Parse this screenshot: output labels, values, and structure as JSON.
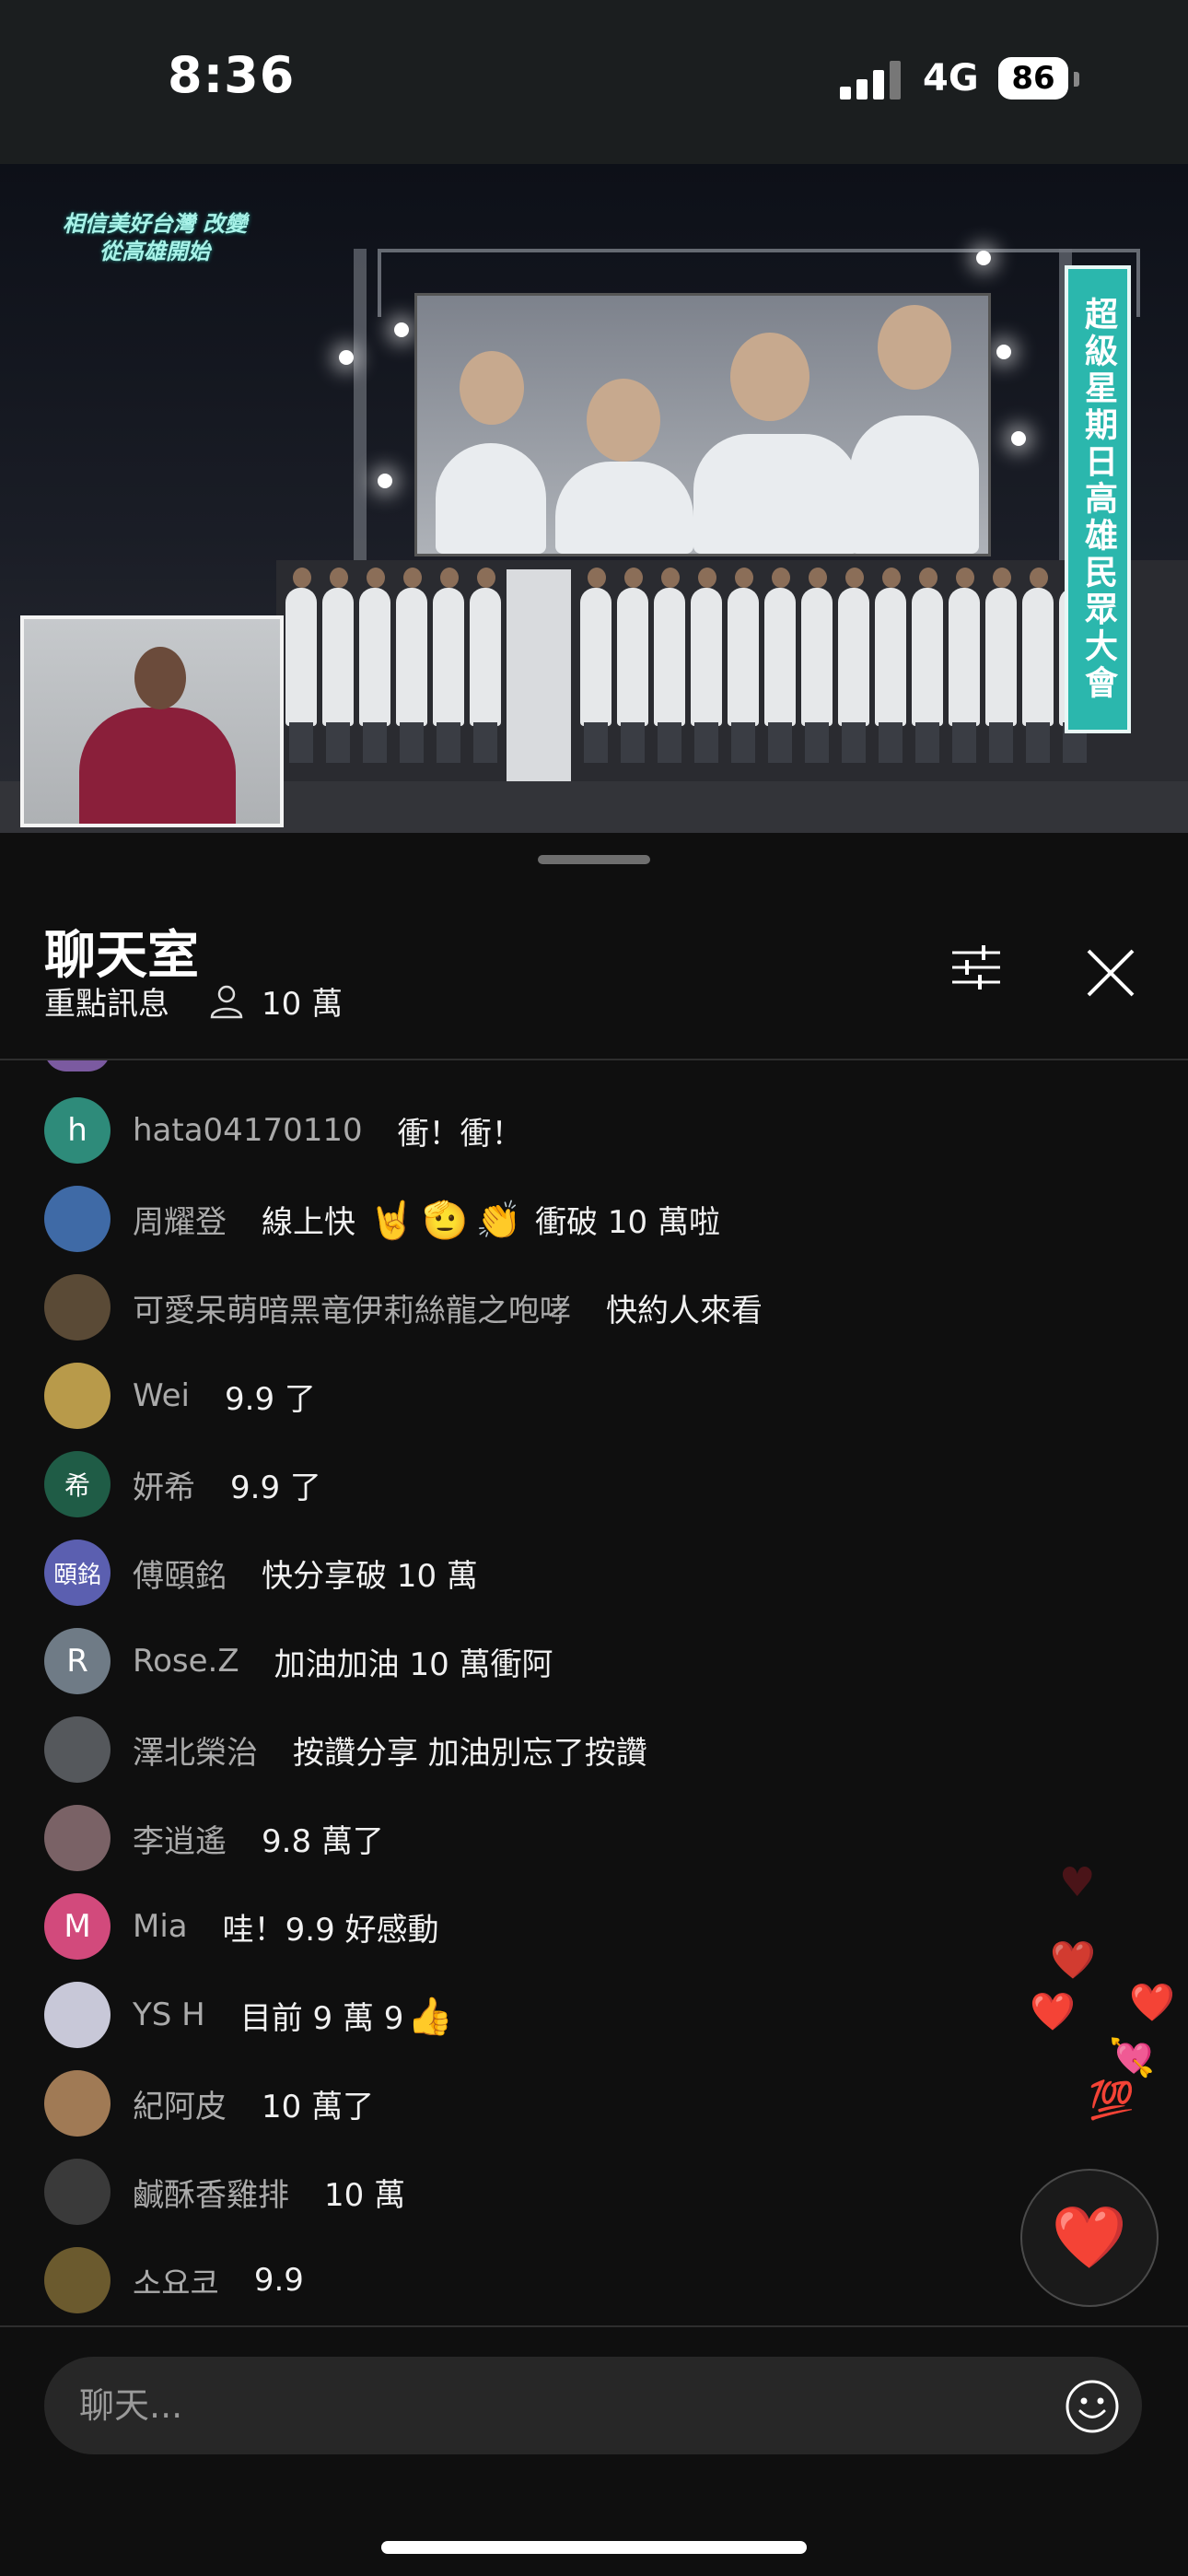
{
  "status_bar": {
    "time": "8:36",
    "network": "4G",
    "battery": "86"
  },
  "video": {
    "slogan": "相信美好台灣 改變從高雄開始",
    "banner": "超級星期日高雄民眾大會"
  },
  "chat": {
    "title": "聊天室",
    "filter_label": "重點訊息",
    "viewer_count": "10 萬",
    "input_placeholder": "聊天...",
    "messages": [
      {
        "author": "hata04170110",
        "text": "衝！衝！",
        "avatar_letter": "h",
        "avatar_color": "#2e8b7a"
      },
      {
        "author": "周耀登",
        "text_before": "線上快",
        "emojis": [
          "🤘",
          "🫡",
          "👏"
        ],
        "text_after": "衝破 10 萬啦",
        "avatar_color": "#3f6aa6"
      },
      {
        "author": "可愛呆萌暗黑竜伊莉絲龍之咆哮",
        "text": "快約人來看",
        "avatar_color": "#5a4a36"
      },
      {
        "author": "Wei",
        "text": "9.9 了",
        "avatar_color": "#b89a4a"
      },
      {
        "author": "妍希",
        "text": "9.9 了",
        "avatar_letter": "希",
        "avatar_color": "#1f5c46"
      },
      {
        "author": "傅頤銘",
        "text": "快分享破 10 萬",
        "avatar_letter": "頤銘",
        "avatar_color": "#5b5fb0"
      },
      {
        "author": "Rose.Z",
        "text": "加油加油 10 萬衝阿",
        "avatar_letter": "R",
        "avatar_color": "#6f7b86"
      },
      {
        "author": "澤北榮治",
        "text": "按讚分享 加油別忘了按讚",
        "avatar_color": "#55585c"
      },
      {
        "author": "李逍遙",
        "text": "9.8 萬了",
        "avatar_color": "#7a6266"
      },
      {
        "author": "Mia",
        "text": "哇！9.9 好感動",
        "avatar_letter": "M",
        "avatar_color": "#d24a7c"
      },
      {
        "author": "YS H",
        "text": "目前 9 萬 9",
        "emoji_after": "👍",
        "avatar_color": "#c8c8d8"
      },
      {
        "author": "紀阿皮",
        "text": "10 萬了",
        "avatar_color": "#a07a55"
      },
      {
        "author": "鹹酥香雞排",
        "text": "10 萬",
        "avatar_color": "#3a3a3a"
      },
      {
        "author": "소요코",
        "text": "9.9",
        "avatar_color": "#6b5a2e"
      }
    ]
  },
  "reactions": {
    "hearts": [
      "♥",
      "❤️",
      "❤️",
      "❤️",
      "💘",
      "💯"
    ],
    "button_icon": "❤️"
  },
  "icons": {
    "filter": "sliders-icon",
    "close": "close-icon",
    "viewer": "person-icon",
    "emoji": "smiley-icon"
  },
  "colors": {
    "background": "#0f0f0f",
    "accent_teal": "#2bb7ad",
    "author_gray": "#aaaaaa"
  }
}
